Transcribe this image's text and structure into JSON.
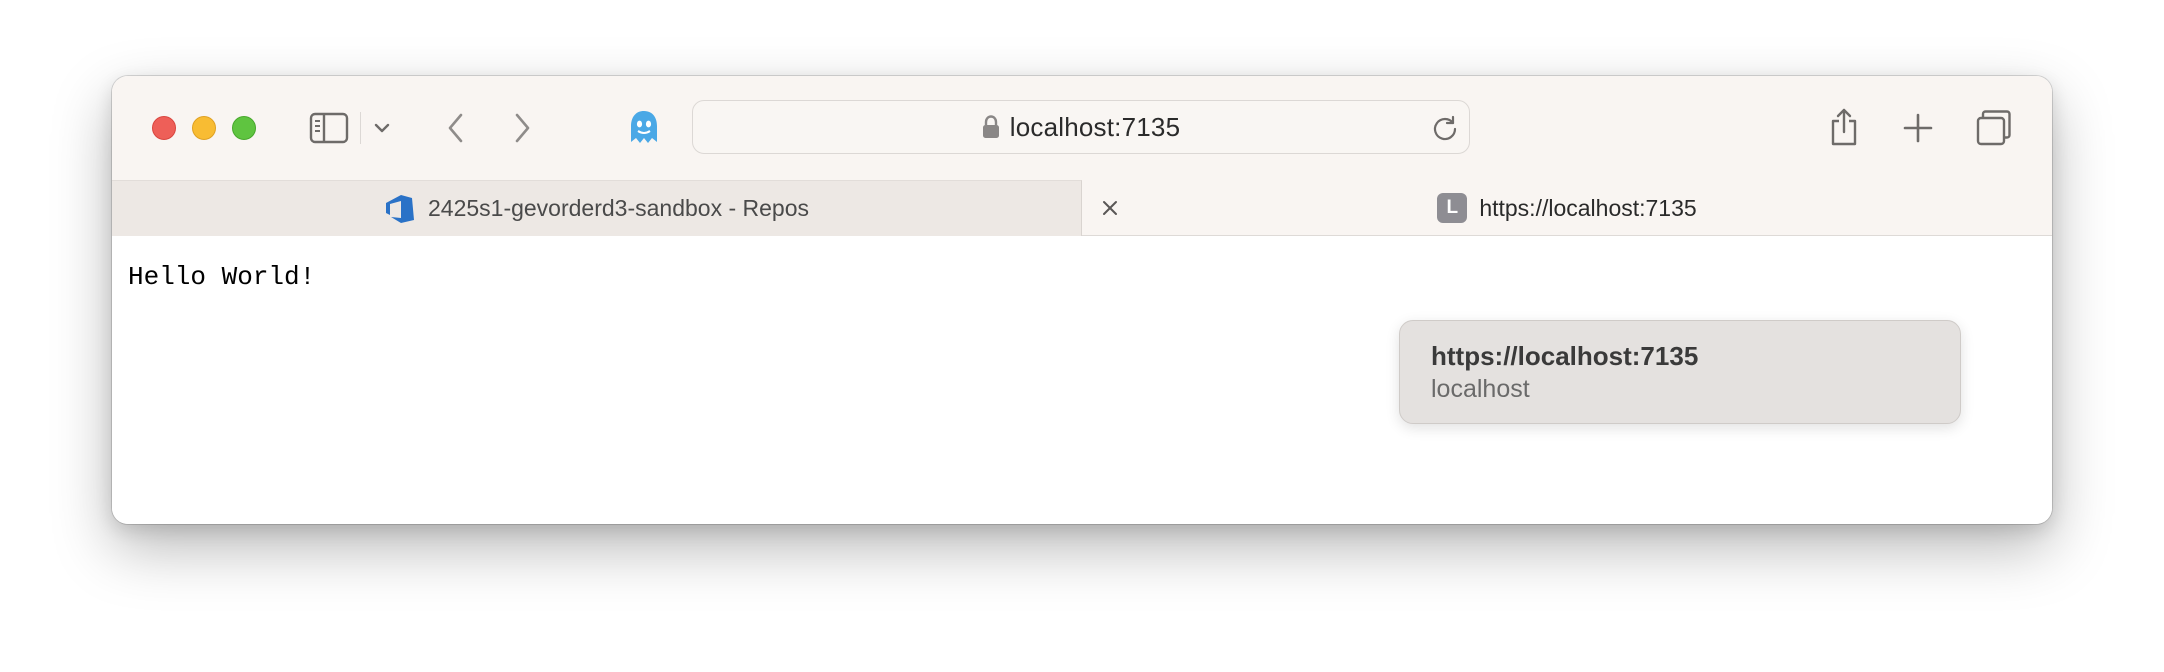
{
  "address_bar": {
    "url": "localhost:7135"
  },
  "tabs": [
    {
      "label": "2425s1-gevorderd3-sandbox - Repos",
      "icon": "azure-devops-icon",
      "active": false
    },
    {
      "label": "https://localhost:7135",
      "favicon_letter": "L",
      "active": true
    }
  ],
  "page": {
    "text": "Hello World!"
  },
  "tooltip": {
    "title": "https://localhost:7135",
    "subtitle": "localhost"
  },
  "colors": {
    "close": "#ee5f58",
    "minimize": "#f8bc33",
    "maximize": "#5fc440",
    "ghost_accent": "#4aa8e6",
    "azure_blue": "#2a72c7"
  }
}
